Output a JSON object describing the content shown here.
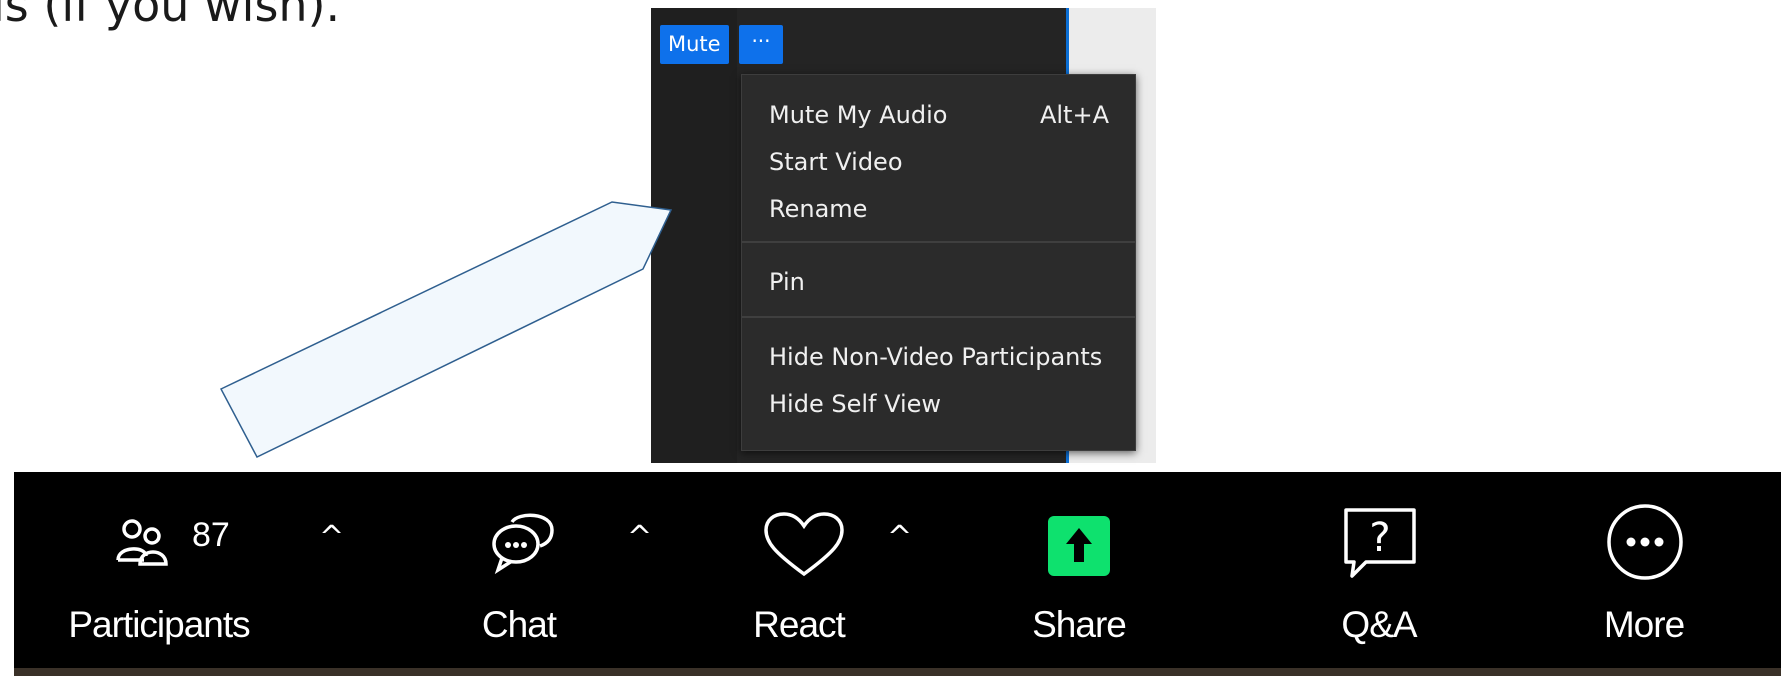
{
  "slide": {
    "text": "is (if you wish)."
  },
  "panel": {
    "mute_label": "Mute",
    "more_label": "···",
    "menu": {
      "items": [
        {
          "label": "Mute My Audio",
          "shortcut": "Alt+A"
        },
        {
          "label": "Start Video"
        },
        {
          "label": "Rename"
        },
        {
          "label": "Pin"
        },
        {
          "label": "Hide Non-Video Participants"
        },
        {
          "label": "Hide Self View"
        }
      ]
    }
  },
  "toolbar": {
    "participants": {
      "label": "Participants",
      "count": "87",
      "icon": "participants-icon"
    },
    "chat": {
      "label": "Chat",
      "icon": "chat-icon"
    },
    "react": {
      "label": "React",
      "icon": "heart-icon"
    },
    "share": {
      "label": "Share",
      "icon": "share-arrow-icon",
      "color": "#0ee16e"
    },
    "qa": {
      "label": "Q&A",
      "icon": "question-icon"
    },
    "more": {
      "label": "More",
      "icon": "more-dots-icon"
    }
  },
  "colors": {
    "accent_blue": "#0e71eb",
    "share_green": "#0ee16e",
    "callout_fill": "#f2f8fd",
    "callout_stroke": "#2f5f8f"
  }
}
